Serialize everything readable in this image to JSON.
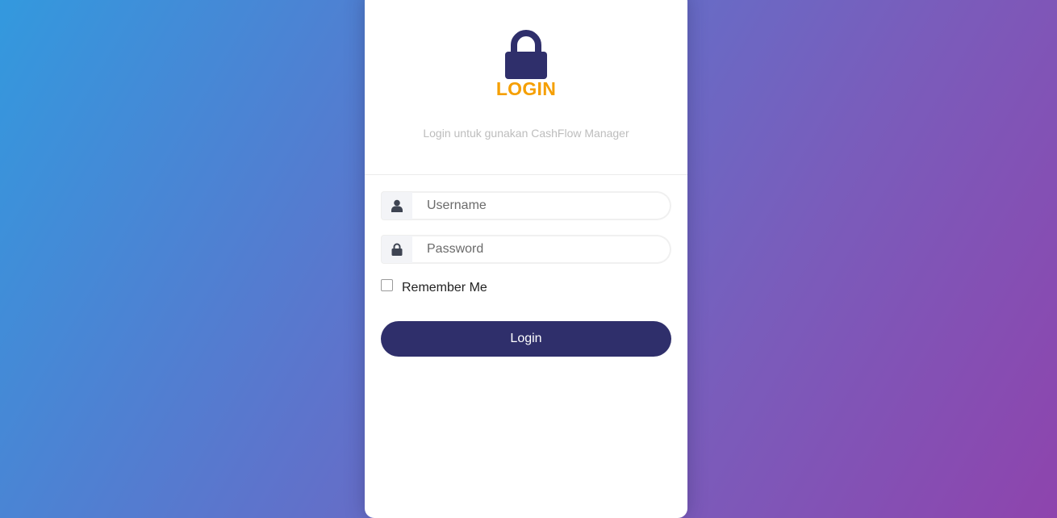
{
  "login_card": {
    "icon": "lock-icon",
    "title": "LOGIN",
    "subtitle": "Login untuk gunakan CashFlow Manager"
  },
  "form": {
    "username": {
      "icon": "user-icon",
      "placeholder": "Username",
      "value": ""
    },
    "password": {
      "icon": "lock-icon",
      "placeholder": "Password",
      "value": ""
    },
    "remember_label": "Remember Me",
    "remember_checked": false,
    "submit_label": "Login"
  },
  "colors": {
    "primary": "#2f2f6b",
    "title": "#f59f00",
    "gradient_start": "#3399de",
    "gradient_end": "#8e44ad"
  }
}
